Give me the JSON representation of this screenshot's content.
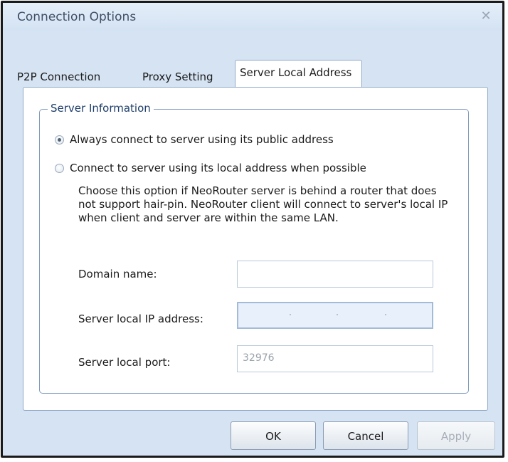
{
  "window": {
    "title": "Connection Options"
  },
  "tabs": [
    {
      "label": "P2P Connection",
      "active": false
    },
    {
      "label": "Proxy Setting",
      "active": false
    },
    {
      "label": "Server Local Address",
      "active": true
    }
  ],
  "group": {
    "legend": "Server Information"
  },
  "options": {
    "public": {
      "label": "Always connect to server using its public address",
      "selected": true
    },
    "local": {
      "label": "Connect to server using its local address when possible",
      "selected": false
    }
  },
  "description": "Choose this option if NeoRouter server is behind a router that does not support hair-pin. NeoRouter client will connect to server's local IP when client and server are within the same LAN.",
  "fields": {
    "domain": {
      "label": "Domain name:",
      "value": ""
    },
    "ip": {
      "label": "Server local IP address:",
      "value": ""
    },
    "port": {
      "label": "Server local port:",
      "value": "32976"
    }
  },
  "buttons": {
    "ok": "OK",
    "cancel": "Cancel",
    "apply": "Apply"
  },
  "icons": {
    "close": "close-icon"
  }
}
